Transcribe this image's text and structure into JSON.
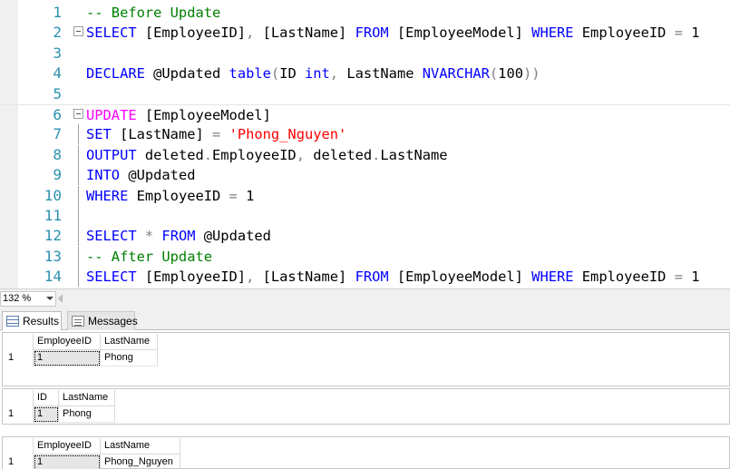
{
  "editor": {
    "lines": [
      {
        "num": "1",
        "fold": "",
        "tokens": [
          {
            "t": "-- Before Update",
            "c": "comment"
          }
        ]
      },
      {
        "num": "2",
        "fold": "start",
        "tokens": [
          {
            "t": "SELECT ",
            "c": "kw"
          },
          {
            "t": "[EmployeeID]",
            "c": "id"
          },
          {
            "t": ", ",
            "c": "gray"
          },
          {
            "t": "[LastName] ",
            "c": "id"
          },
          {
            "t": "FROM ",
            "c": "kw"
          },
          {
            "t": "[EmployeeModel] ",
            "c": "id"
          },
          {
            "t": "WHERE ",
            "c": "kw"
          },
          {
            "t": "EmployeeID ",
            "c": "id"
          },
          {
            "t": "= ",
            "c": "gray"
          },
          {
            "t": "1",
            "c": "id"
          }
        ]
      },
      {
        "num": "3",
        "fold": "",
        "tokens": []
      },
      {
        "num": "4",
        "fold": "",
        "tokens": [
          {
            "t": "DECLARE ",
            "c": "kw"
          },
          {
            "t": "@Updated ",
            "c": "id"
          },
          {
            "t": "table",
            "c": "kw"
          },
          {
            "t": "(",
            "c": "gray"
          },
          {
            "t": "ID ",
            "c": "id"
          },
          {
            "t": "int",
            "c": "kw"
          },
          {
            "t": ", ",
            "c": "gray"
          },
          {
            "t": "LastName ",
            "c": "id"
          },
          {
            "t": "NVARCHAR",
            "c": "kw"
          },
          {
            "t": "(",
            "c": "gray"
          },
          {
            "t": "100",
            "c": "id"
          },
          {
            "t": "))",
            "c": "gray"
          }
        ]
      },
      {
        "num": "5",
        "fold": "",
        "tokens": []
      },
      {
        "num": "6",
        "fold": "start",
        "tokens": [
          {
            "t": "UPDATE ",
            "c": "dml"
          },
          {
            "t": "[EmployeeModel]",
            "c": "id"
          }
        ]
      },
      {
        "num": "7",
        "fold": "line",
        "tokens": [
          {
            "t": "SET ",
            "c": "kw"
          },
          {
            "t": "[LastName] ",
            "c": "id"
          },
          {
            "t": "= ",
            "c": "gray"
          },
          {
            "t": "'Phong_Nguyen'",
            "c": "str"
          }
        ]
      },
      {
        "num": "8",
        "fold": "line",
        "tokens": [
          {
            "t": "OUTPUT ",
            "c": "kw"
          },
          {
            "t": "deleted",
            "c": "id"
          },
          {
            "t": ".",
            "c": "gray"
          },
          {
            "t": "EmployeeID",
            "c": "id"
          },
          {
            "t": ", ",
            "c": "gray"
          },
          {
            "t": "deleted",
            "c": "id"
          },
          {
            "t": ".",
            "c": "gray"
          },
          {
            "t": "LastName",
            "c": "id"
          }
        ]
      },
      {
        "num": "9",
        "fold": "line",
        "tokens": [
          {
            "t": "INTO ",
            "c": "kw"
          },
          {
            "t": "@Updated",
            "c": "id"
          }
        ]
      },
      {
        "num": "10",
        "fold": "line",
        "tokens": [
          {
            "t": "WHERE ",
            "c": "kw"
          },
          {
            "t": "EmployeeID ",
            "c": "id"
          },
          {
            "t": "= ",
            "c": "gray"
          },
          {
            "t": "1",
            "c": "id"
          }
        ]
      },
      {
        "num": "11",
        "fold": "line",
        "tokens": []
      },
      {
        "num": "12",
        "fold": "line",
        "tokens": [
          {
            "t": "SELECT ",
            "c": "kw"
          },
          {
            "t": "* ",
            "c": "gray"
          },
          {
            "t": "FROM ",
            "c": "kw"
          },
          {
            "t": "@Updated",
            "c": "id"
          }
        ]
      },
      {
        "num": "13",
        "fold": "line",
        "tokens": [
          {
            "t": "-- After Update",
            "c": "comment"
          }
        ]
      },
      {
        "num": "14",
        "fold": "line",
        "tokens": [
          {
            "t": "SELECT ",
            "c": "kw"
          },
          {
            "t": "[EmployeeID]",
            "c": "id"
          },
          {
            "t": ", ",
            "c": "gray"
          },
          {
            "t": "[LastName] ",
            "c": "id"
          },
          {
            "t": "FROM ",
            "c": "kw"
          },
          {
            "t": "[EmployeeModel] ",
            "c": "id"
          },
          {
            "t": "WHERE ",
            "c": "kw"
          },
          {
            "t": "EmployeeID ",
            "c": "id"
          },
          {
            "t": "= ",
            "c": "gray"
          },
          {
            "t": "1",
            "c": "id"
          }
        ]
      }
    ]
  },
  "zoom": {
    "value": "132 %"
  },
  "tabs": {
    "results_label": "Results",
    "messages_label": "Messages"
  },
  "grids": [
    {
      "columns": [
        "EmployeeID",
        "LastName"
      ],
      "rows": [
        {
          "num": "1",
          "cells": [
            "1",
            "Phong"
          ]
        }
      ]
    },
    {
      "columns": [
        "ID",
        "LastName"
      ],
      "rows": [
        {
          "num": "1",
          "cells": [
            "1",
            "Phong"
          ]
        }
      ]
    },
    {
      "columns": [
        "EmployeeID",
        "LastName"
      ],
      "rows": [
        {
          "num": "1",
          "cells": [
            "1",
            "Phong_Nguyen"
          ]
        }
      ]
    }
  ]
}
